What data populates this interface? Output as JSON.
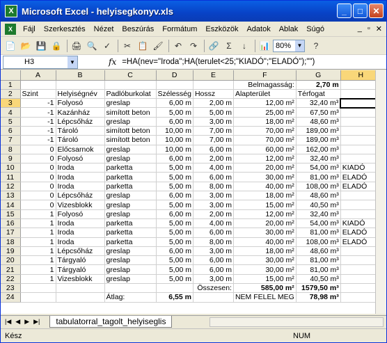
{
  "window": {
    "title": "Microsoft Excel - helyisegkonyv.xls"
  },
  "menu": [
    "Fájl",
    "Szerkesztés",
    "Nézet",
    "Beszúrás",
    "Formátum",
    "Eszközök",
    "Adatok",
    "Ablak",
    "Súgó"
  ],
  "toolbar": {
    "zoom": "80%"
  },
  "formula_bar": {
    "cell": "H3",
    "formula": "=HA(nev=\"Iroda\";HA(terulet<25;\"KIADÓ\";\"ELADÓ\");\"\")"
  },
  "columns": [
    "A",
    "B",
    "C",
    "D",
    "E",
    "F",
    "G",
    "H"
  ],
  "rows": [
    [
      "",
      "",
      "",
      "",
      "",
      "Belmagasság:",
      "2,70 m",
      ""
    ],
    [
      "Szint",
      "Helyiségnév",
      "Padlóburkolat",
      "Szélesség",
      "Hossz",
      "Alapterület",
      "Térfogat",
      ""
    ],
    [
      "-1",
      "Folyosó",
      "greslap",
      "6,00 m",
      "2,00 m",
      "12,00 m²",
      "32,40 m³",
      ""
    ],
    [
      "-1",
      "Kazánház",
      "simított beton",
      "5,00 m",
      "5,00 m",
      "25,00 m²",
      "67,50 m³",
      ""
    ],
    [
      "-1",
      "Lépcsőház",
      "greslap",
      "6,00 m",
      "3,00 m",
      "18,00 m²",
      "48,60 m³",
      ""
    ],
    [
      "-1",
      "Tároló",
      "simított beton",
      "10,00 m",
      "7,00 m",
      "70,00 m²",
      "189,00 m³",
      ""
    ],
    [
      "-1",
      "Tároló",
      "simított beton",
      "10,00 m",
      "7,00 m",
      "70,00 m²",
      "189,00 m³",
      ""
    ],
    [
      "0",
      "Előcsarnok",
      "greslap",
      "10,00 m",
      "6,00 m",
      "60,00 m²",
      "162,00 m³",
      ""
    ],
    [
      "0",
      "Folyosó",
      "greslap",
      "6,00 m",
      "2,00 m",
      "12,00 m²",
      "32,40 m³",
      ""
    ],
    [
      "0",
      "Iroda",
      "parketta",
      "5,00 m",
      "4,00 m",
      "20,00 m²",
      "54,00 m³",
      "KIADÓ"
    ],
    [
      "0",
      "Iroda",
      "parketta",
      "5,00 m",
      "6,00 m",
      "30,00 m²",
      "81,00 m³",
      "ELADÓ"
    ],
    [
      "0",
      "Iroda",
      "parketta",
      "5,00 m",
      "8,00 m",
      "40,00 m²",
      "108,00 m³",
      "ELADÓ"
    ],
    [
      "0",
      "Lépcsőház",
      "greslap",
      "6,00 m",
      "3,00 m",
      "18,00 m²",
      "48,60 m³",
      ""
    ],
    [
      "0",
      "Vizesblokk",
      "greslap",
      "5,00 m",
      "3,00 m",
      "15,00 m²",
      "40,50 m³",
      ""
    ],
    [
      "1",
      "Folyosó",
      "greslap",
      "6,00 m",
      "2,00 m",
      "12,00 m²",
      "32,40 m³",
      ""
    ],
    [
      "1",
      "Iroda",
      "parketta",
      "5,00 m",
      "4,00 m",
      "20,00 m²",
      "54,00 m³",
      "KIADÓ"
    ],
    [
      "1",
      "Iroda",
      "parketta",
      "5,00 m",
      "6,00 m",
      "30,00 m²",
      "81,00 m³",
      "ELADÓ"
    ],
    [
      "1",
      "Iroda",
      "parketta",
      "5,00 m",
      "8,00 m",
      "40,00 m²",
      "108,00 m³",
      "ELADÓ"
    ],
    [
      "1",
      "Lépcsőház",
      "greslap",
      "6,00 m",
      "3,00 m",
      "18,00 m²",
      "48,60 m³",
      ""
    ],
    [
      "1",
      "Tárgyaló",
      "greslap",
      "5,00 m",
      "6,00 m",
      "30,00 m²",
      "81,00 m³",
      ""
    ],
    [
      "1",
      "Tárgyaló",
      "greslap",
      "5,00 m",
      "6,00 m",
      "30,00 m²",
      "81,00 m³",
      ""
    ],
    [
      "1",
      "Vizesblokk",
      "greslap",
      "5,00 m",
      "3,00 m",
      "15,00 m²",
      "40,50 m³",
      ""
    ],
    [
      "",
      "",
      "",
      "",
      "Összesen:",
      "585,00 m²",
      "1579,50 m³",
      ""
    ],
    [
      "",
      "",
      "Átlag:",
      "6,55 m",
      "",
      "NEM FELEL MEG",
      "78,98 m³",
      ""
    ]
  ],
  "sheet_tab": "tabulatorral_tagolt_helyiseglis",
  "status": {
    "left": "Kész",
    "num": "NUM"
  }
}
